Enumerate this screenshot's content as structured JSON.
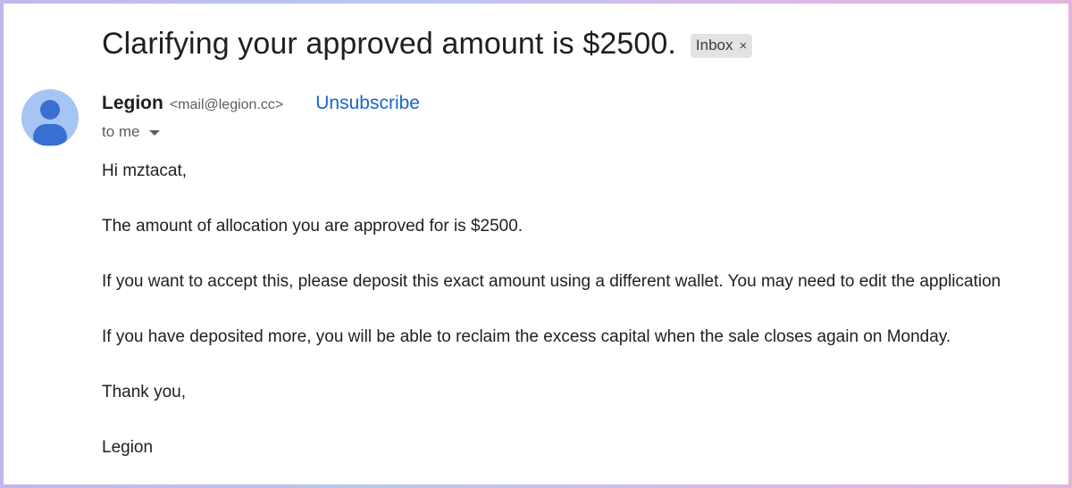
{
  "email": {
    "subject": "Clarifying your approved amount is $2500.",
    "label": {
      "text": "Inbox",
      "remove_symbol": "×"
    },
    "sender": {
      "name": "Legion",
      "email": "<mail@legion.cc>",
      "unsubscribe_label": "Unsubscribe"
    },
    "recipient_label": "to me",
    "body": [
      "Hi mztacat,",
      "The amount of allocation you are approved for is $2500.",
      "If you want to accept this, please deposit this exact amount using a different wallet. You may need to edit the application",
      "If you have deposited more, you will be able to reclaim the excess capital when the sale closes again on Monday.",
      "Thank you,",
      "Legion"
    ]
  },
  "colors": {
    "link": "#1a66c8",
    "avatar_bg": "#a6c5f4",
    "avatar_fg": "#3a6fd2",
    "chip_bg": "#e3e3e3"
  },
  "icons": {
    "avatar": "person-avatar-icon",
    "recipient_toggle": "caret-down-icon",
    "label_remove": "close-icon"
  }
}
